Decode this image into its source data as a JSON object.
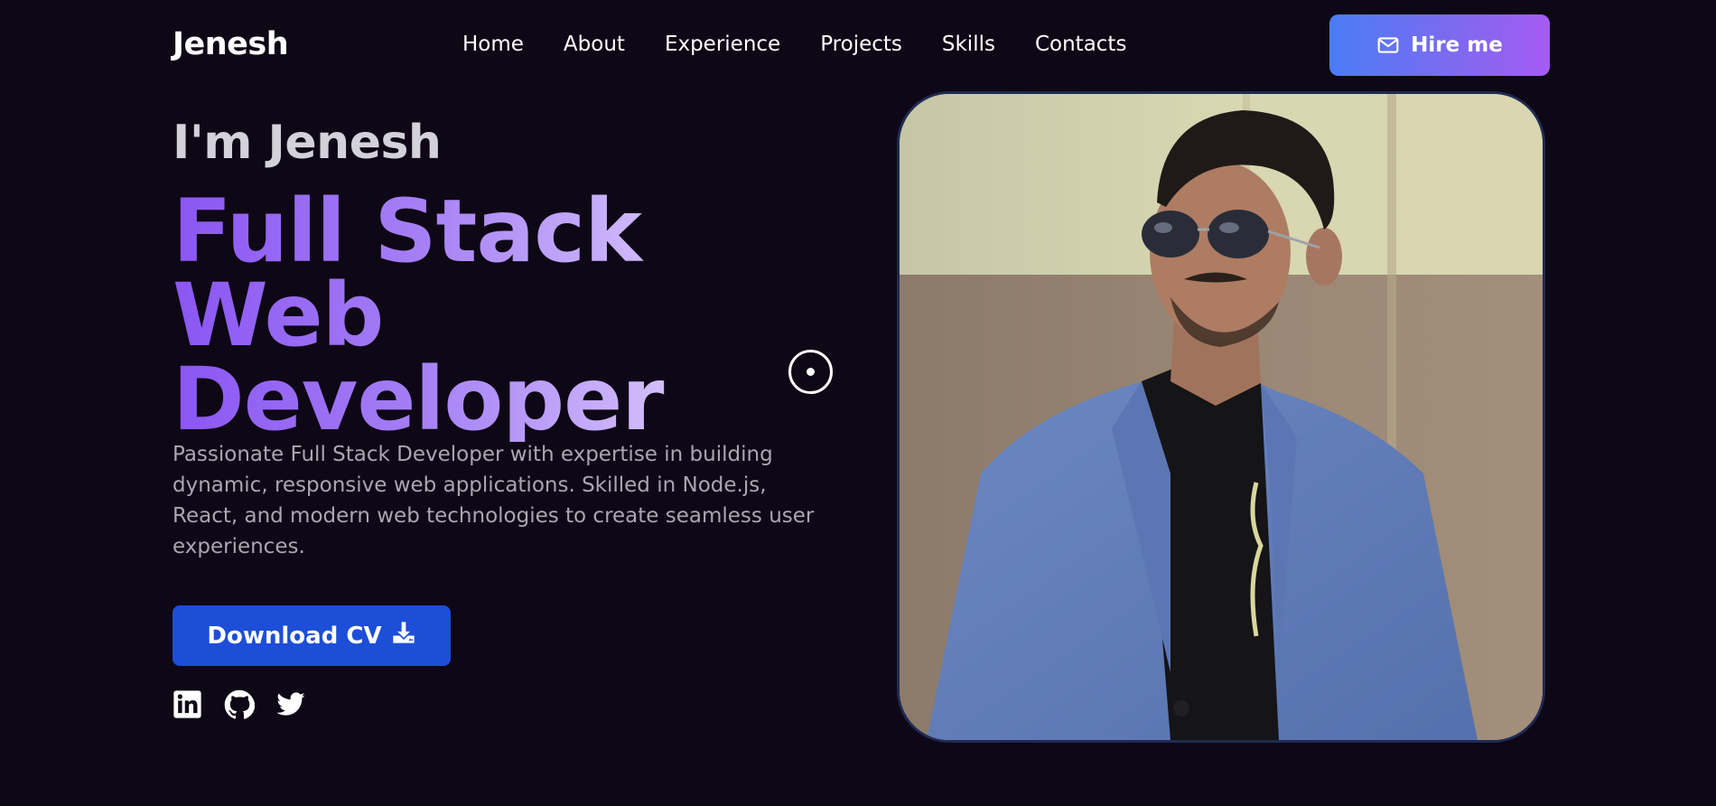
{
  "header": {
    "brand": "Jenesh",
    "nav": [
      "Home",
      "About",
      "Experience",
      "Projects",
      "Skills",
      "Contacts"
    ],
    "hire_button": {
      "label": "Hire me",
      "icon": "mail-icon"
    }
  },
  "hero": {
    "intro": "I'm Jenesh",
    "headline": [
      "Full Stack",
      "Web",
      "Developer"
    ],
    "description": "Passionate Full Stack Developer with expertise in building dynamic, responsive web applications. Skilled in Node.js, React, and modern web technologies to create seamless user experiences.",
    "cv_button": {
      "label": "Download CV",
      "icon": "download-icon"
    },
    "socials": [
      {
        "name": "LinkedIn",
        "icon": "linkedin-icon"
      },
      {
        "name": "GitHub",
        "icon": "github-icon"
      },
      {
        "name": "Twitter",
        "icon": "twitter-icon"
      }
    ],
    "portrait_alt": "Portrait of Jenesh"
  },
  "colors": {
    "background": "#0e0716",
    "accent_purple": "#8b55f3",
    "accent_light": "#e8dcfd",
    "cv_button": "#1d4ed8",
    "hire_gradient_start": "#4a7df5",
    "hire_gradient_end": "#a55bf5",
    "muted_text": "#a9a6b1"
  }
}
